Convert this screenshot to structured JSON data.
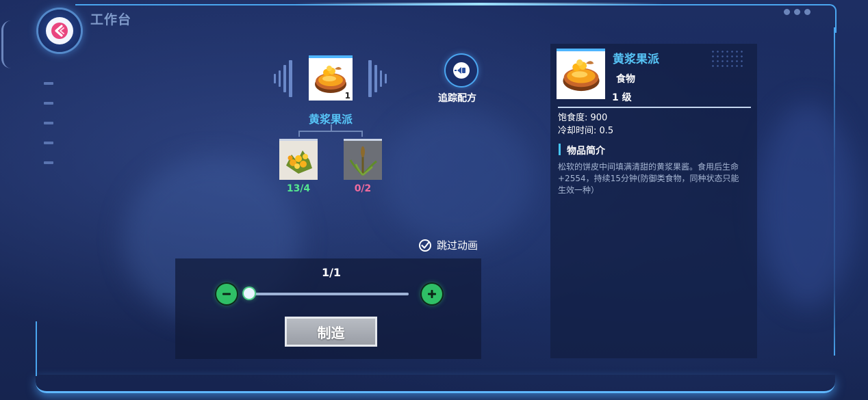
{
  "header": {
    "title": "工作台"
  },
  "colors": {
    "accent": "#57c5f7",
    "frame": "#4aa6f0",
    "have_enough": "#54e58f",
    "not_enough": "#f06b9e"
  },
  "recipe": {
    "product": {
      "name": "黄浆果派",
      "quantity_badge": "1",
      "icon": "golden-pie-icon"
    },
    "materials": [
      {
        "icon": "yellow-berries-icon",
        "count": "13/4"
      },
      {
        "icon": "reed-grass-icon",
        "count": "0/2"
      }
    ]
  },
  "track_recipe": {
    "label": "追踪配方",
    "icon": "track-target-icon"
  },
  "craft": {
    "skip_animation_label": "跳过动画",
    "skip_animation_checked": true,
    "count_text": "1/1",
    "button_label": "制造"
  },
  "detail": {
    "name": "黄浆果派",
    "type": "食物",
    "level": "1 级",
    "stats": [
      "饱食度: 900",
      "冷却时间: 0.5"
    ],
    "section_title": "物品简介",
    "description": "松软的饼皮中间填满清甜的黄浆果酱。食用后生命+2554，持续15分钟(防御类食物，同种状态只能生效一种）"
  }
}
